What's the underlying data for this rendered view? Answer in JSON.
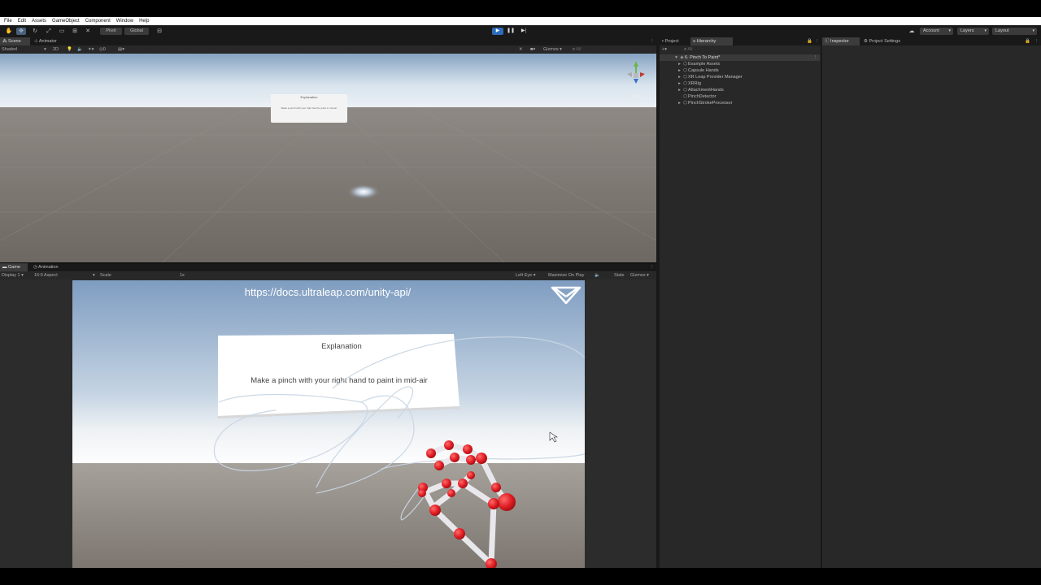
{
  "menu": [
    "File",
    "Edit",
    "Assets",
    "GameObject",
    "Component",
    "Window",
    "Help"
  ],
  "toolbar": {
    "pivot_label": "Pivot",
    "global_label": "Global",
    "account_label": "Account",
    "layers_label": "Layers",
    "layout_label": "Layout"
  },
  "scene_panel": {
    "tabs": [
      "Scene",
      "Animator"
    ],
    "shading_mode": "Shaded",
    "mode_2d": "2D",
    "gizmos_label": "Gizmos",
    "search_placeholder": "All",
    "persp_label": "Persp",
    "panel_title": "Explanation",
    "panel_text": "Make a pinch with your right hand to paint in mid-air"
  },
  "game_panel": {
    "tabs": [
      "Game",
      "Animation"
    ],
    "display": "Display 1",
    "aspect": "16:9 Aspect",
    "scale_label": "Scale",
    "scale_value": "1x",
    "eye": "Left Eye",
    "maximize_label": "Maximize On Play",
    "stats_label": "Stats",
    "gizmos_label": "Gizmos",
    "url": "https://docs.ultraleap.com/unity-api/",
    "panel_title": "Explanation",
    "panel_text": "Make a pinch with your right hand to paint in mid-air"
  },
  "hierarchy_panel": {
    "tabs": [
      "Project",
      "Hierarchy"
    ],
    "search_placeholder": "All",
    "scene_name": "6. Pinch To Paint*",
    "items": [
      {
        "label": "Example Assets",
        "expandable": true
      },
      {
        "label": "Capsule Hands",
        "expandable": true
      },
      {
        "label": "XR Leap Provider Manager",
        "expandable": true
      },
      {
        "label": "XRRig",
        "expandable": true
      },
      {
        "label": "AttachmentHands",
        "expandable": true
      },
      {
        "label": "PinchDetector",
        "expandable": false
      },
      {
        "label": "PinchStrokeProcessor",
        "expandable": true
      }
    ]
  },
  "inspector_panel": {
    "tabs": [
      "Inspector",
      "Project Settings"
    ]
  },
  "colors": {
    "editor_bg": "#282828",
    "toolbar_bg": "#191919",
    "play_active": "#2c6cb8",
    "hand_joint": "#e01e24",
    "hand_bone": "#e8e8ec"
  }
}
